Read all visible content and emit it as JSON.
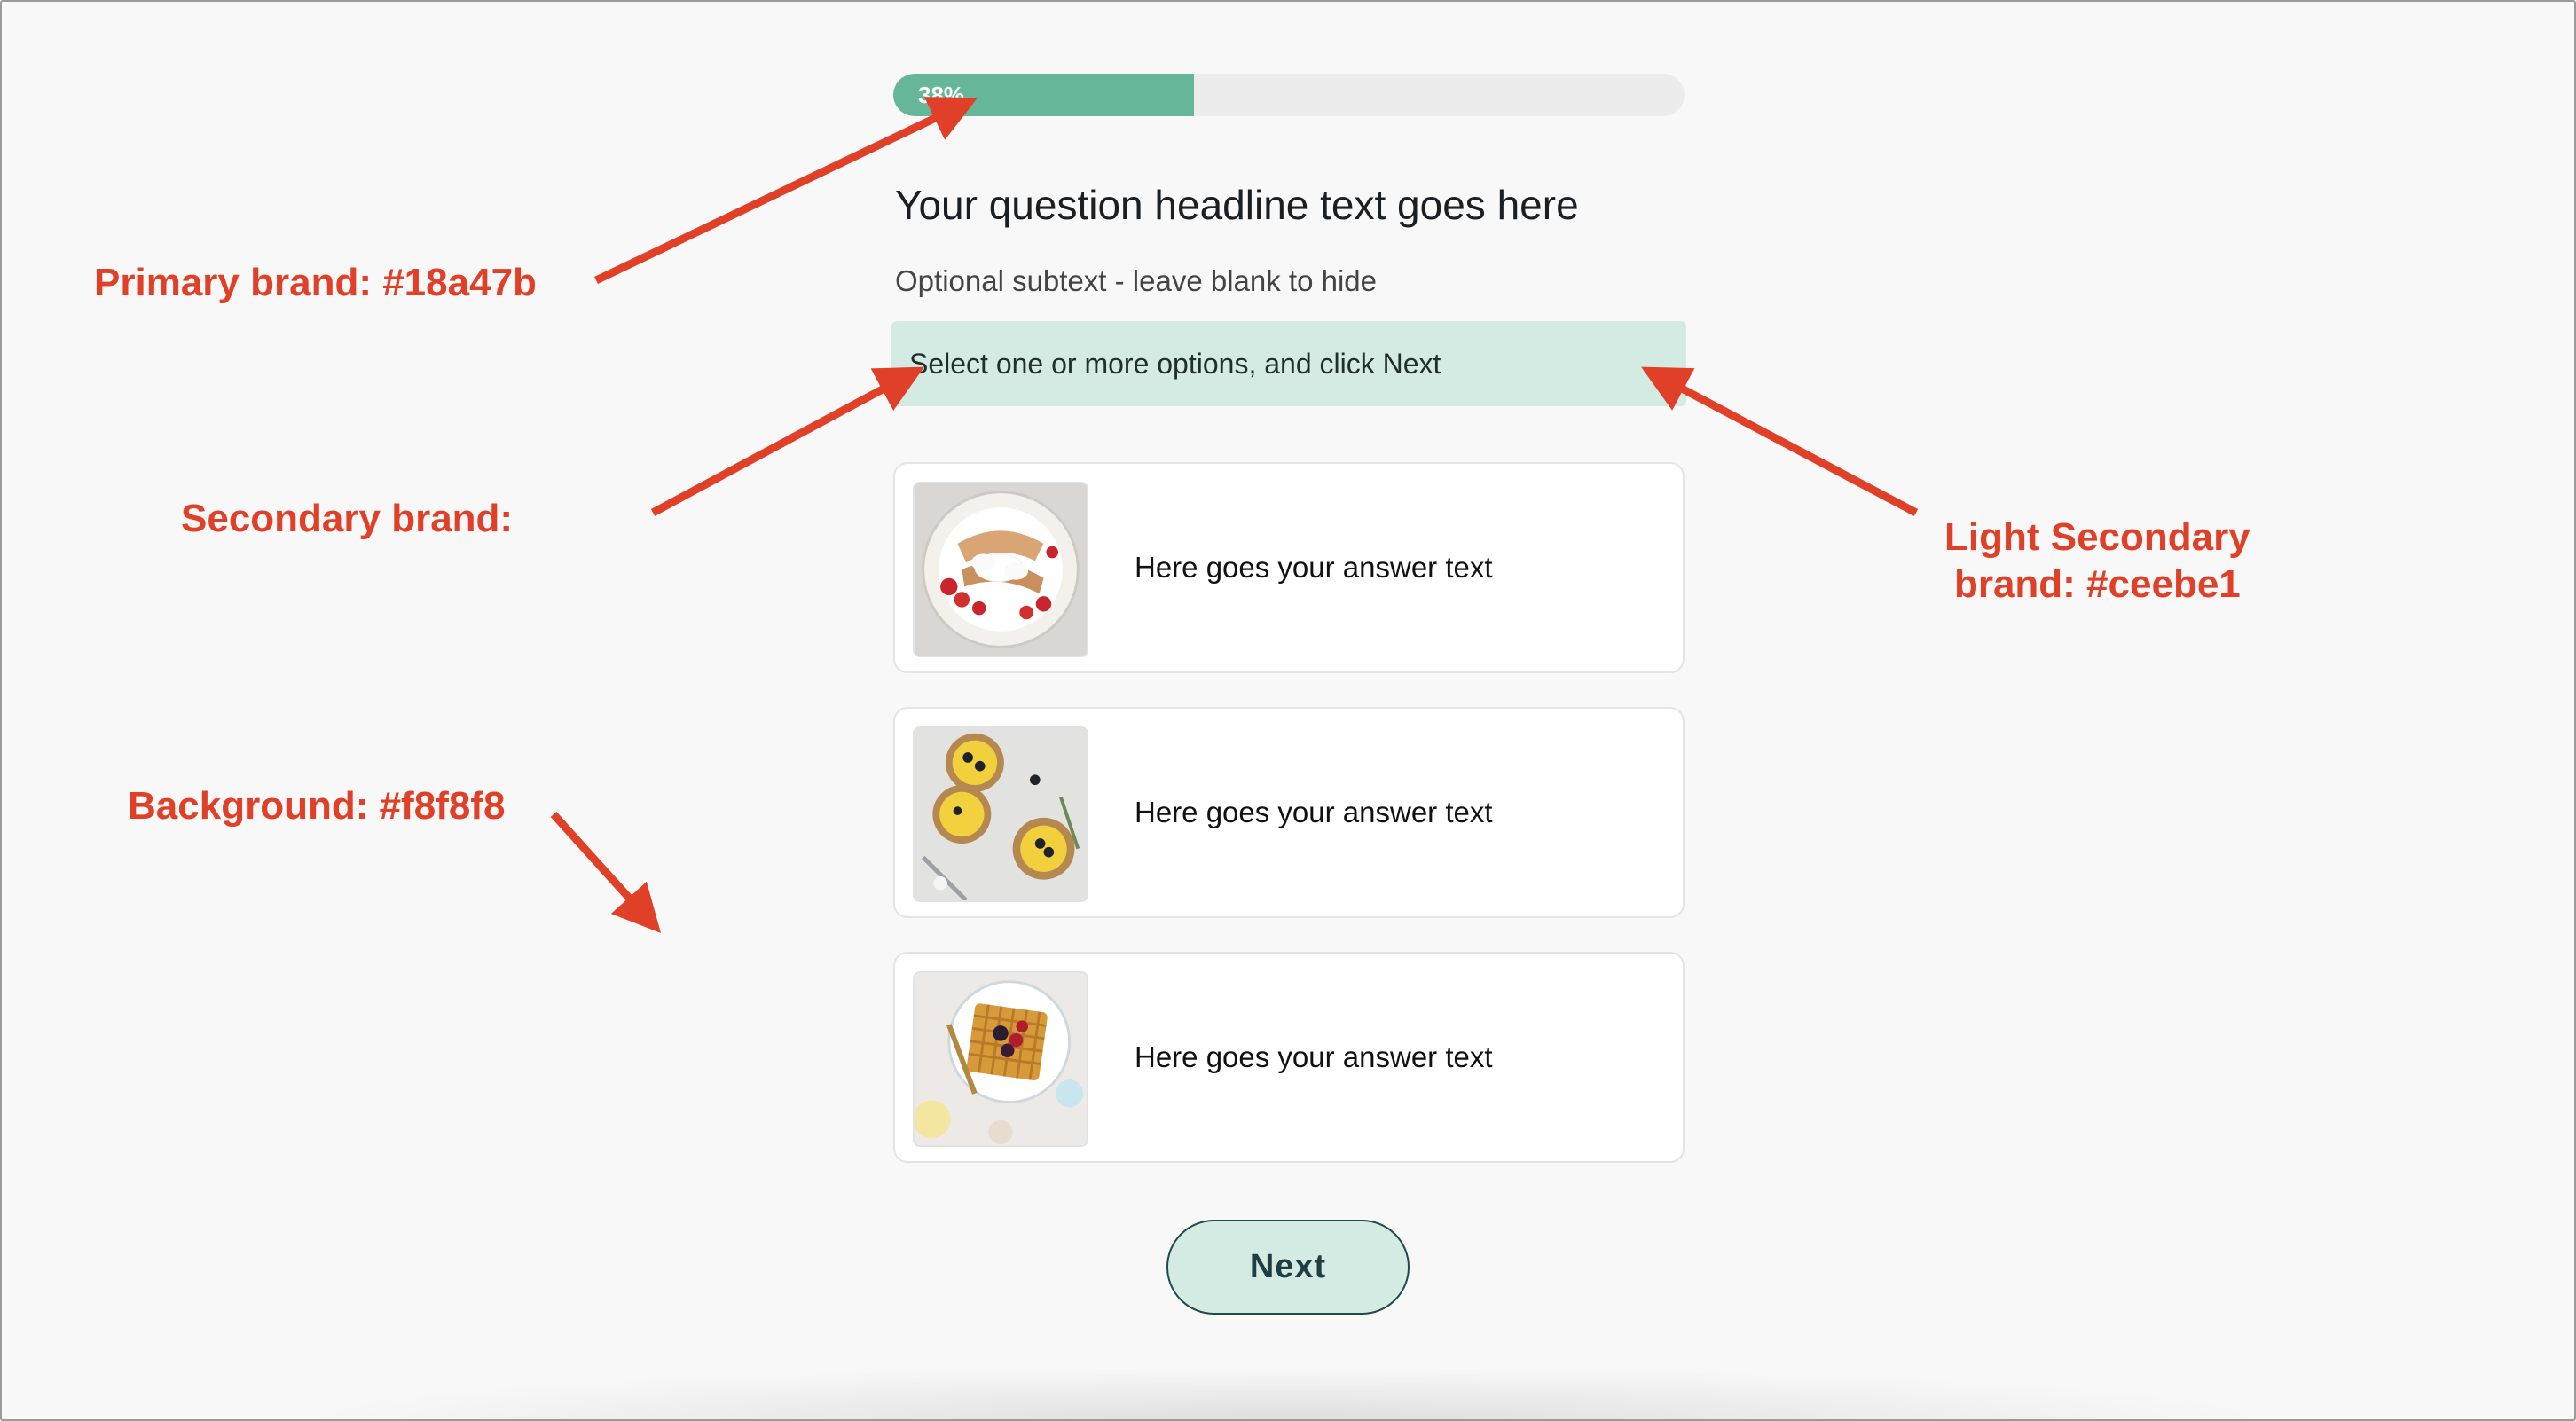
{
  "progress": {
    "label": "38%",
    "fraction": 0.38
  },
  "question": {
    "headline": "Your question headline text goes here",
    "subtext": "Optional subtext - leave blank to hide",
    "instruction": "Select one or more options, and click Next"
  },
  "options": [
    {
      "label": "Here goes your answer text",
      "image": "crepes-with-strawberries-and-cream"
    },
    {
      "label": "Here goes your answer text",
      "image": "lemon-berry-tartlets"
    },
    {
      "label": "Here goes your answer text",
      "image": "waffle-with-berries"
    }
  ],
  "next_label": "Next",
  "annotations": {
    "primary": "Primary brand: #18a47b",
    "secondary": "Secondary brand:",
    "light_secondary_line1": "Light Secondary",
    "light_secondary_line2": "brand: #ceebe1",
    "background": "Background: #f8f8f8"
  },
  "colors": {
    "primary_brand": "#18a47b",
    "light_secondary_brand": "#ceebe1",
    "background": "#f8f8f8",
    "annotation": "#e04027"
  }
}
